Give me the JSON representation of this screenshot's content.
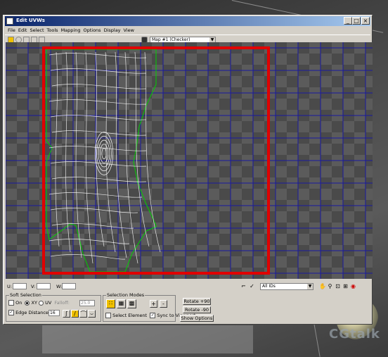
{
  "window": {
    "title": "Edit UVWs",
    "controls": {
      "minimize": "_",
      "maximize": "□",
      "close": "×"
    }
  },
  "menu": {
    "items": [
      "File",
      "Edit",
      "Select",
      "Tools",
      "Mapping",
      "Options",
      "Display",
      "View"
    ]
  },
  "toolbar": {
    "map_dropdown": "Map #1 (Checker)",
    "tools": [
      "move-icon",
      "rotate-icon",
      "scale-icon",
      "freeform-icon",
      "mirror-icon"
    ]
  },
  "coords": {
    "u_label": "U:",
    "v_label": "V:",
    "w_label": "W:",
    "channel_dropdown": "All IDs"
  },
  "soft_selection": {
    "title": "Soft Selection",
    "on_label": "On",
    "xy_label": "XY",
    "uv_label": "UV",
    "falloff_label": "Falloff:",
    "falloff_value": "25.0",
    "edge_distance_label": "Edge Distance",
    "edge_distance_value": "16",
    "edge_distance_checked": true
  },
  "selection_modes": {
    "title": "Selection Modes",
    "select_element_label": "Select Element",
    "sync_label": "Sync to Viewport",
    "sync_checked": true,
    "plus": "+",
    "minus": "-"
  },
  "rotate": {
    "plus90": "Rotate +90",
    "minus90": "Rotate -90",
    "show_options": "Show Options"
  },
  "watermark": "CGtalk",
  "colors": {
    "highlight_box": "#e00000",
    "grid_line": "#1a1aa0",
    "mesh": "#ffffff",
    "seam": "#00d000"
  }
}
